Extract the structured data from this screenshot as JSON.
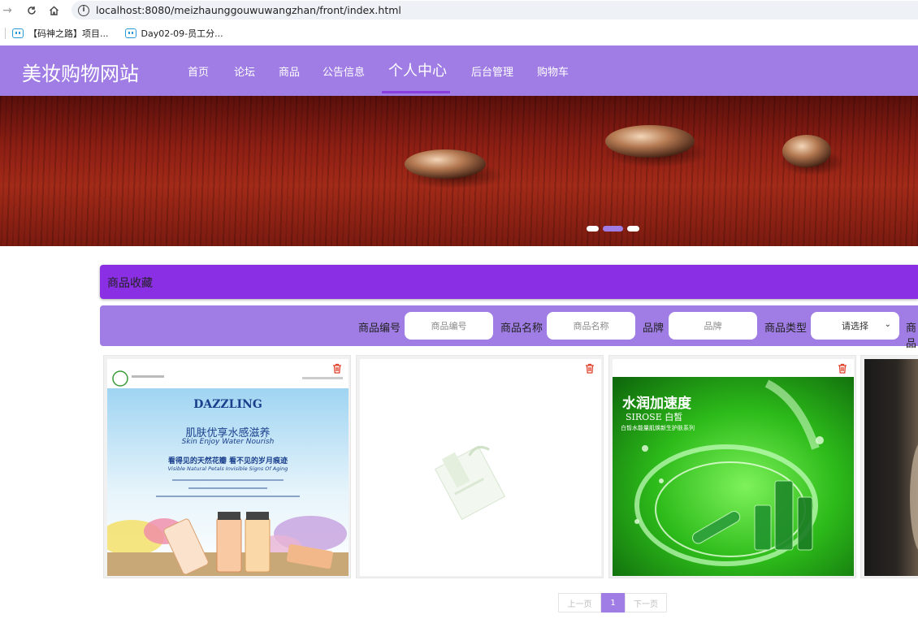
{
  "browser": {
    "url": "localhost:8080/meizhaunggouwuwangzhan/front/index.html",
    "bookmarks": [
      "【码神之路】项目...",
      "Day02-09-员工分..."
    ]
  },
  "header": {
    "logo": "美妆购物网站",
    "nav": [
      "首页",
      "论坛",
      "商品",
      "公告信息",
      "个人中心",
      "后台管理",
      "购物车"
    ],
    "active_nav": "个人中心"
  },
  "carousel": {
    "slide_count": 3,
    "active_slide": 2
  },
  "section": {
    "title": "商品收藏"
  },
  "search": {
    "code_label": "商品编号",
    "code_placeholder": "商品编号",
    "name_label": "商品名称",
    "name_placeholder": "商品名称",
    "brand_label": "品牌",
    "brand_placeholder": "品牌",
    "type_label": "商品类型",
    "type_value": "请选择",
    "cut_label": "商品"
  },
  "products": [
    {
      "image": "dazzling-poster",
      "brand_text": "DAZZLING",
      "headline": "肌肤优享水感滋养",
      "sub_en": "Skin Enjoy Water Nourish",
      "line2": "看得见的天然花瓣   看不见的岁月痕迹",
      "line2_en": "Visible Natural Petals    Invisible Signs Of Aging"
    },
    {
      "image": "faded-product-box"
    },
    {
      "image": "green-water-ring",
      "headline": "水润加速度",
      "sub_en": "SIROSE 白皙",
      "line2": "白皙水能量肌焕新生护肤系列"
    },
    {
      "image": "dark-product-partial"
    }
  ],
  "pagination": {
    "prev": "上一页",
    "current": "1",
    "next": "下一页"
  },
  "colors": {
    "header": "#a07de4",
    "section_title": "#8b2fe4",
    "trash": "#e0402a"
  }
}
